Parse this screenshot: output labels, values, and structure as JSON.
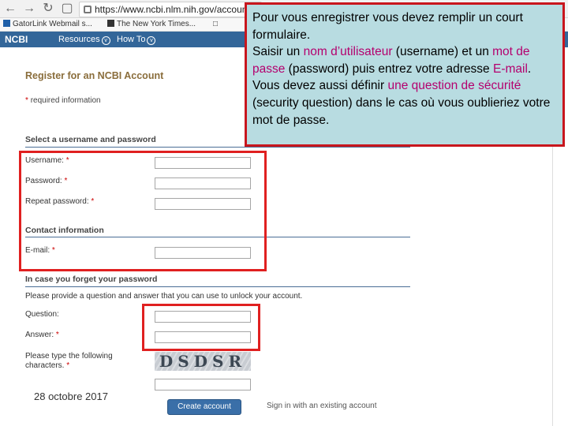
{
  "browser": {
    "url": "https://www.ncbi.nlm.nih.gov/account",
    "url_visible": "https://www.ncbi.nlm.nih.gov/accoun",
    "bookmarks": [
      "GatorLink Webmail s...",
      "The New York Times..."
    ],
    "icons": [
      "back-arrow-icon",
      "forward-arrow-icon",
      "reload-icon",
      "lock-icon",
      "page-icon"
    ]
  },
  "ncbi_header": {
    "logo": "NCBI",
    "menu": [
      "Resources",
      "How To"
    ]
  },
  "form": {
    "title": "Register for an NCBI Account",
    "required_note": "required information",
    "required_star": "*",
    "sections": {
      "credentials": "Select a username and password",
      "contact": "Contact information",
      "security": "In case you forget your password"
    },
    "labels": {
      "username": "Username:",
      "password": "Password:",
      "repeat_password": "Repeat password:",
      "email": "E-mail:",
      "question": "Question:",
      "answer": "Answer:",
      "captcha_line1": "Please type the following",
      "captcha_line2": "characters."
    },
    "security_help": "Please provide a question and answer that you can use to unlock your account.",
    "captcha_text": "DSDSR",
    "create_button": "Create account",
    "signin_link": "Sign in with an existing account"
  },
  "callout": {
    "line1": "Pour vous enregistrer vous devez remplir un court formulaire.",
    "part2a": "Saisir un ",
    "part2b": "nom d’utilisateur",
    "part2c": " (username) et un ",
    "part2d": "mot de passe",
    "part2e": " (password) puis entrez votre adresse ",
    "part2f": "E-mail",
    "part2g": ".",
    "part3a": "Vous devez aussi définir ",
    "part3b": "une question de sécurité",
    "part3c": " (security question) dans le cas où vous oublieriez votre mot de passe."
  },
  "footer_date": "28 octobre 2017",
  "colors": {
    "highlight": "#e02020",
    "callout_bg": "#b8dce1",
    "callout_border": "#c8161d",
    "callout_emphasis": "#b4006e",
    "ncbi_blue": "#336699"
  }
}
